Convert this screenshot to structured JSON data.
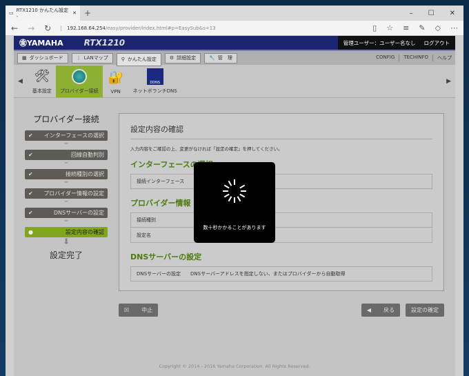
{
  "browser": {
    "tab_title": "RTX1210 かんたん設定 -",
    "url_host": "192.168.64.254",
    "url_path": "/easy/provider/index.html#p=EasySub&s=13"
  },
  "header": {
    "logo": "㊎YAMAHA",
    "model": "RTX1210",
    "user": "管理ユーザー：ユーザー名なし",
    "logout": "ログアウト"
  },
  "nav": {
    "tabs": [
      "ダッシュボード",
      "LANマップ",
      "かんたん設定",
      "詳細設定",
      "管　理"
    ],
    "active": 2,
    "links": [
      "CONFIG",
      "TECHINFO",
      "ヘルプ"
    ]
  },
  "icons": [
    {
      "label": "基本設定",
      "icon": "tools-icon"
    },
    {
      "label": "プロバイダー接続",
      "icon": "globe-icon",
      "active": true
    },
    {
      "label": "VPN",
      "icon": "lock-icon"
    },
    {
      "label": "ネットボランチDNS",
      "icon": "dns-icon"
    }
  ],
  "sidebar": {
    "title": "プロバイダー接続",
    "steps": [
      "インターフェースの選択",
      "回線自動判別",
      "接続種別の選択",
      "プロバイダー情報の設定",
      "DNSサーバーの設定",
      "設定内容の確認"
    ],
    "current": 5,
    "done": "設定完了"
  },
  "main": {
    "title": "設定内容の確認",
    "description": "入力内容をご確認の上、変更がなければ「設定の確定」を押してください。",
    "sections": [
      {
        "title": "インターフェースの選択",
        "rows": [
          [
            "接続インターフェース",
            ""
          ]
        ]
      },
      {
        "title": "プロバイダー情報",
        "rows": [
          [
            "接続種別",
            ""
          ],
          [
            "設定名",
            ""
          ]
        ]
      },
      {
        "title": "DNSサーバーの設定",
        "rows": [
          [
            "DNSサーバーの設定",
            "DNSサーバーアドレスを指定しない、またはプロバイダーから自動取得"
          ]
        ]
      }
    ]
  },
  "buttons": {
    "cancel": "中止",
    "back": "戻る",
    "confirm": "設定の確定"
  },
  "modal": {
    "message": "数十秒かかることがあります"
  },
  "footer": "Copyright © 2014 - 2016 Yamaha Corporation. All Rights Reserved."
}
